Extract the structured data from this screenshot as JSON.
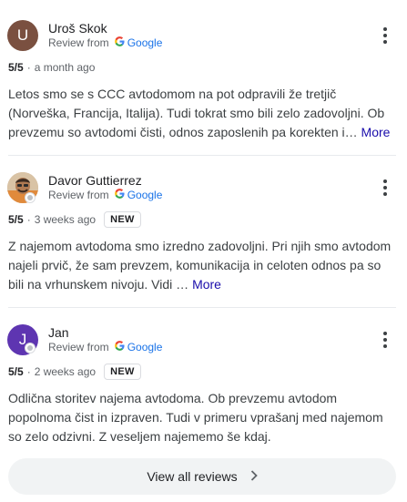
{
  "reviews": [
    {
      "avatar_letter": "U",
      "avatar_color": "#7a5040",
      "name": "Uroš Skok",
      "source_prefix": "Review from",
      "source_name": "Google",
      "rating": "5/5",
      "separator": "·",
      "time": "a month ago",
      "is_new": false,
      "text": "Letos smo se s CCC avtodomom na pot odpravili že tretjič (Norveška, Francija, Italija). Tudi tokrat smo bili zelo zadovoljni. Ob prevzemu so avtodomi čisti, odnos zaposlenih pa korekten i…",
      "more_label": "More"
    },
    {
      "avatar_letter": "",
      "avatar_color": "#c9a27a",
      "name": "Davor Guttierrez",
      "source_prefix": "Review from",
      "source_name": "Google",
      "rating": "5/5",
      "separator": "·",
      "time": "3 weeks ago",
      "is_new": true,
      "new_label": "NEW",
      "text": "Z najemom avtodoma smo izredno zadovoljni. Pri njih smo avtodom najeli prvič, že sam prevzem, komunikacija in celoten odnos pa so bili na vrhunskem nivoju. Vidi …",
      "more_label": "More"
    },
    {
      "avatar_letter": "J",
      "avatar_color": "#5e35b1",
      "name": "Jan",
      "source_prefix": "Review from",
      "source_name": "Google",
      "rating": "5/5",
      "separator": "·",
      "time": "2 weeks ago",
      "is_new": true,
      "new_label": "NEW",
      "text": "Odlična storitev najema avtodoma. Ob prevzemu avtodom popolnoma čist in izpraven. Tudi v primeru vprašanj med najemom so zelo odzivni. Z veseljem najememo še kdaj.",
      "more_label": ""
    }
  ],
  "view_all": {
    "label": "View all reviews",
    "icon": "chevron-right-icon"
  },
  "colors": {
    "google_blue": "#1a73e8",
    "more_link": "#1a0dab",
    "divider": "#e8eaed",
    "button_bg": "#f1f3f4"
  }
}
